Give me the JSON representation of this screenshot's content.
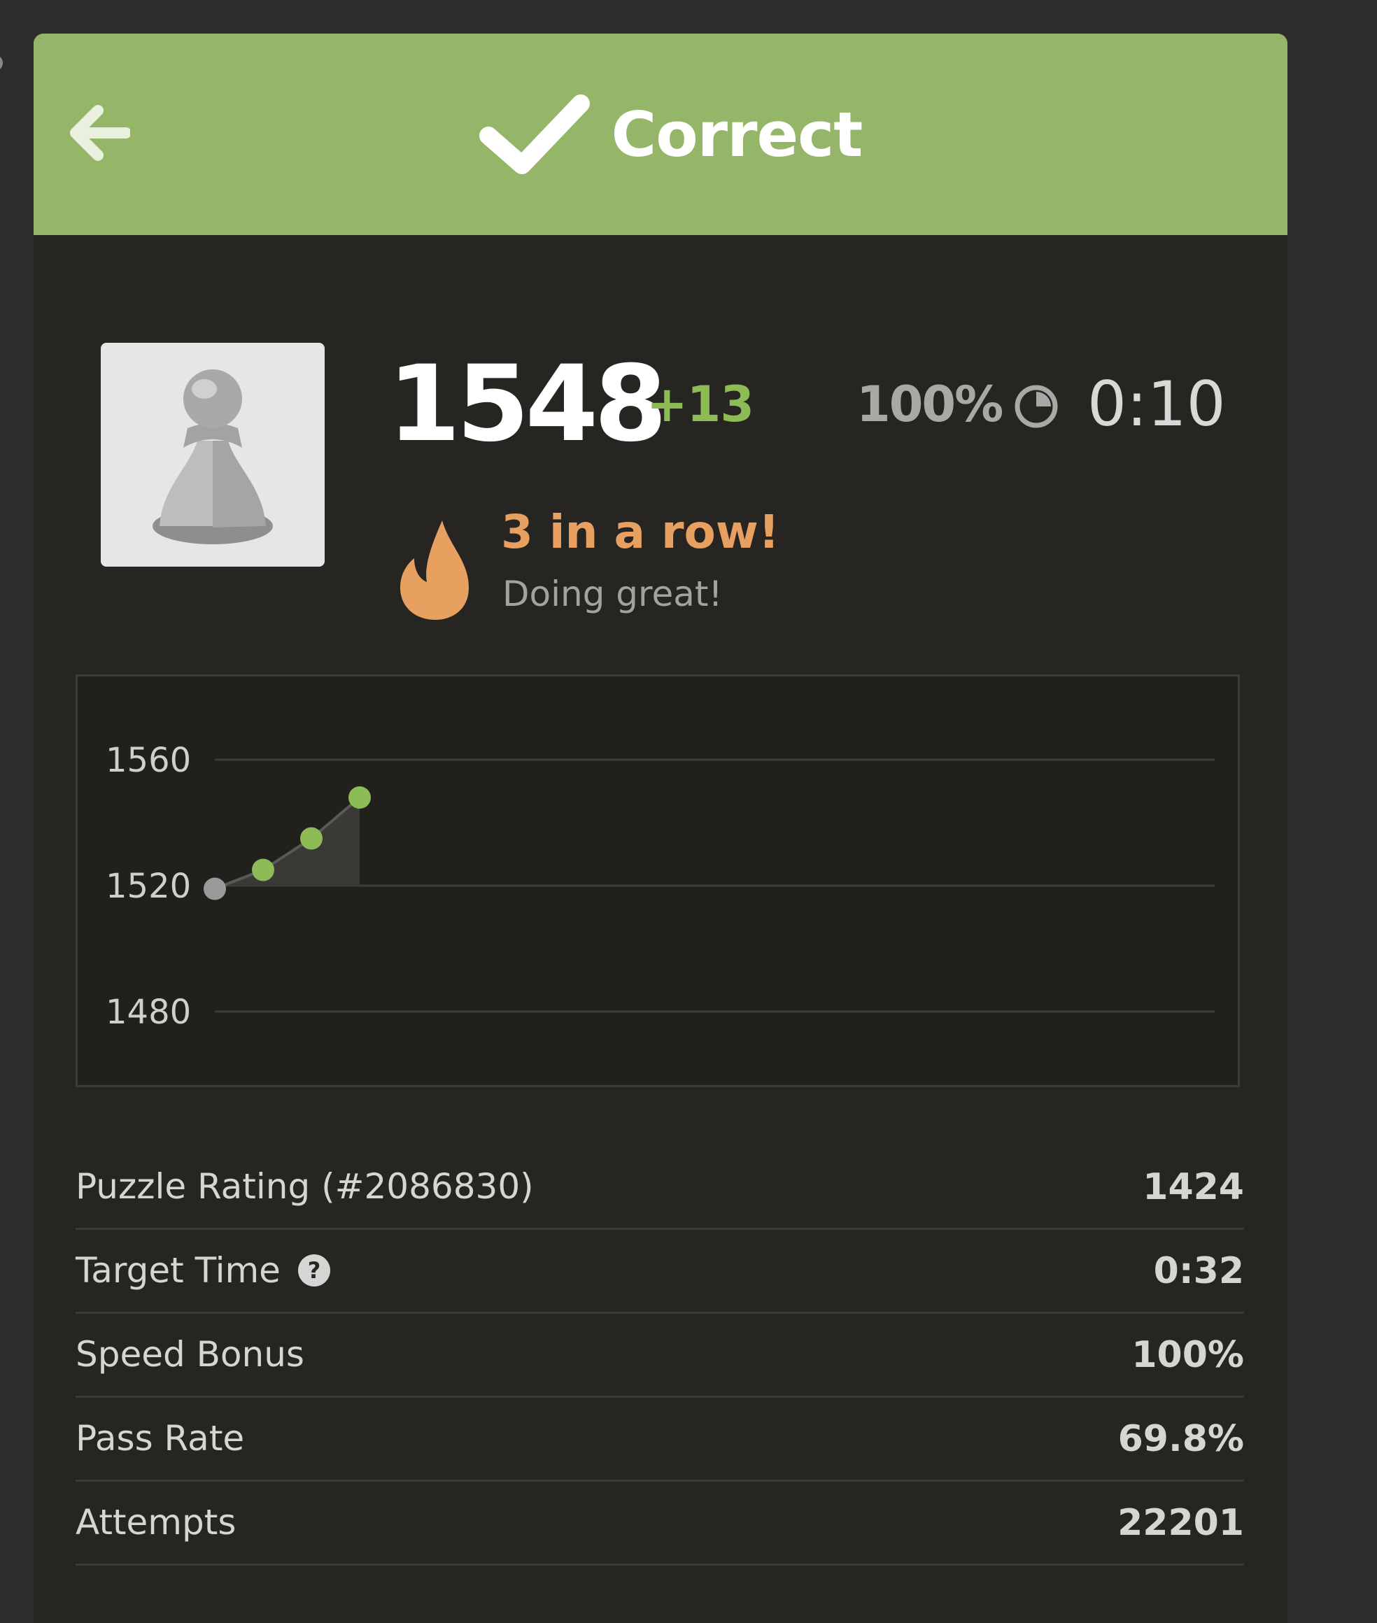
{
  "header": {
    "title": "Correct",
    "background": "#95b568",
    "icons": {
      "back": "arrow-left-icon",
      "status": "checkmark-icon"
    }
  },
  "player": {
    "avatar_icon": "pawn-icon",
    "rating": "1548",
    "rating_change": "+13",
    "speed_percent": "100%",
    "clock_icon": "clock-icon",
    "time": "0:10"
  },
  "streak": {
    "icon": "flame-icon",
    "title": "3 in a row!",
    "subtitle": "Doing great!",
    "color": "#e8a060"
  },
  "chart_data": {
    "type": "line",
    "y_ticks": [
      "1560",
      "1520",
      "1480"
    ],
    "ylim": [
      1480,
      1560
    ],
    "x": [
      1,
      2,
      3,
      4
    ],
    "values": [
      1519,
      1525,
      1535,
      1548
    ],
    "grid": true,
    "colors": {
      "start_point": "#9a9a9a",
      "points": "#8dbb55",
      "line": "#5a5956",
      "fill": "#3a3936"
    }
  },
  "stats": [
    {
      "label": "Puzzle Rating (#2086830)",
      "value": "1424"
    },
    {
      "label": "Target Time",
      "value": "0:32",
      "help_icon": "question-mark-icon"
    },
    {
      "label": "Speed Bonus",
      "value": "100%"
    },
    {
      "label": "Pass Rate",
      "value": "69.8%"
    },
    {
      "label": "Attempts",
      "value": "22201"
    }
  ]
}
